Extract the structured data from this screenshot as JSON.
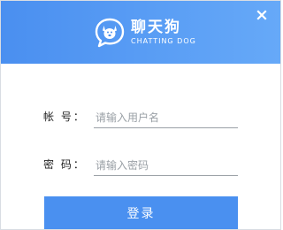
{
  "header": {
    "app_name": "聊天狗",
    "app_subtitle": "CHATTING DOG",
    "logo_icon": "chat-bubble-dog-icon",
    "close_icon": "close-icon",
    "background_color": "#4a8ff0"
  },
  "form": {
    "account": {
      "label": "帐  号：",
      "value": "",
      "placeholder": "请输入用户名"
    },
    "password": {
      "label": "密  码：",
      "value": "",
      "placeholder": "请输入密码"
    },
    "submit_label": "登录",
    "accent_color": "#4a90f0"
  }
}
